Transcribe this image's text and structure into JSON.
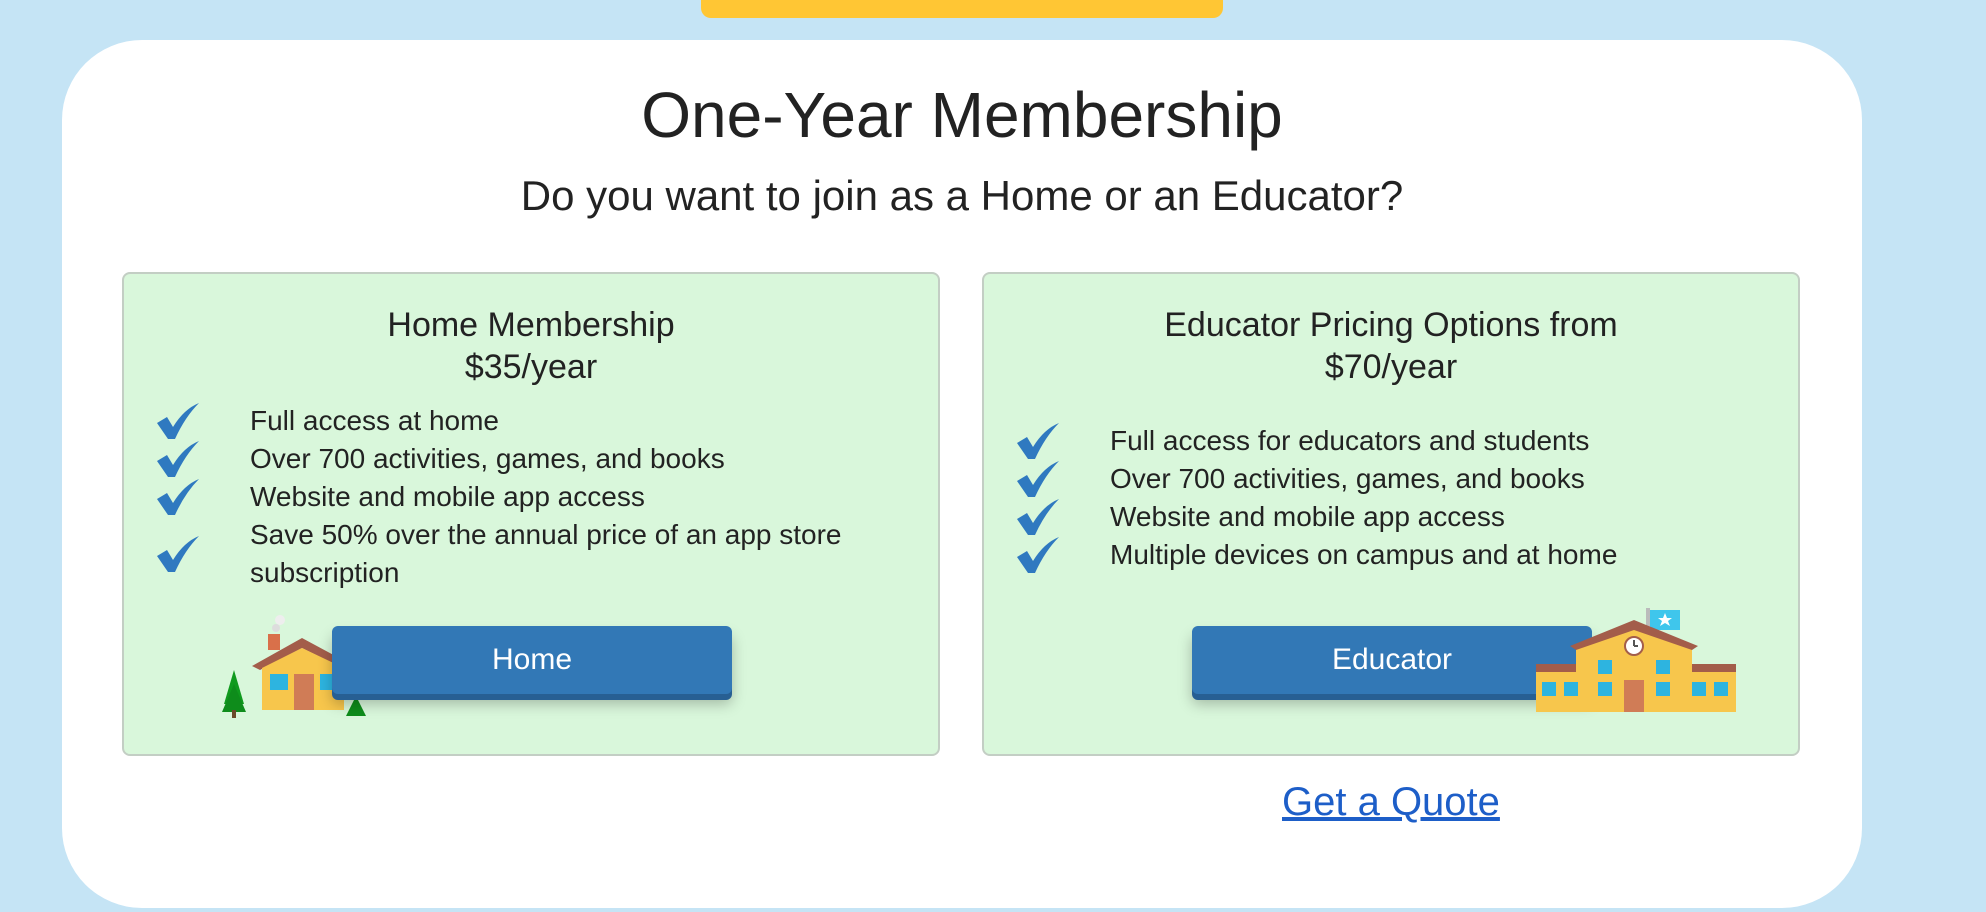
{
  "header": {
    "title": "One-Year Membership",
    "subtitle": "Do you want to join as a Home or an Educator?"
  },
  "home": {
    "title_line1": "Home Membership",
    "title_line2": "$35/year",
    "features": [
      "Full access at home",
      "Over 700 activities, games, and books",
      "Website and mobile app access",
      "Save 50% over the annual price of an app store subscription"
    ],
    "button_label": "Home",
    "icon": "house-icon"
  },
  "educator": {
    "title_line1": "Educator Pricing Options from",
    "title_line2": "$70/year",
    "features": [
      "Full access for educators and students",
      "Over 700 activities, games, and books",
      "Website and mobile app access",
      "Multiple devices on campus and at home"
    ],
    "button_label": "Educator",
    "icon": "school-icon"
  },
  "quote_link": "Get a Quote",
  "colors": {
    "background": "#c5e4f5",
    "accent_bar": "#ffc634",
    "panel_bg": "#d9f7db",
    "button": "#3278b6",
    "check": "#2f79c0",
    "link": "#1d5ec8"
  }
}
